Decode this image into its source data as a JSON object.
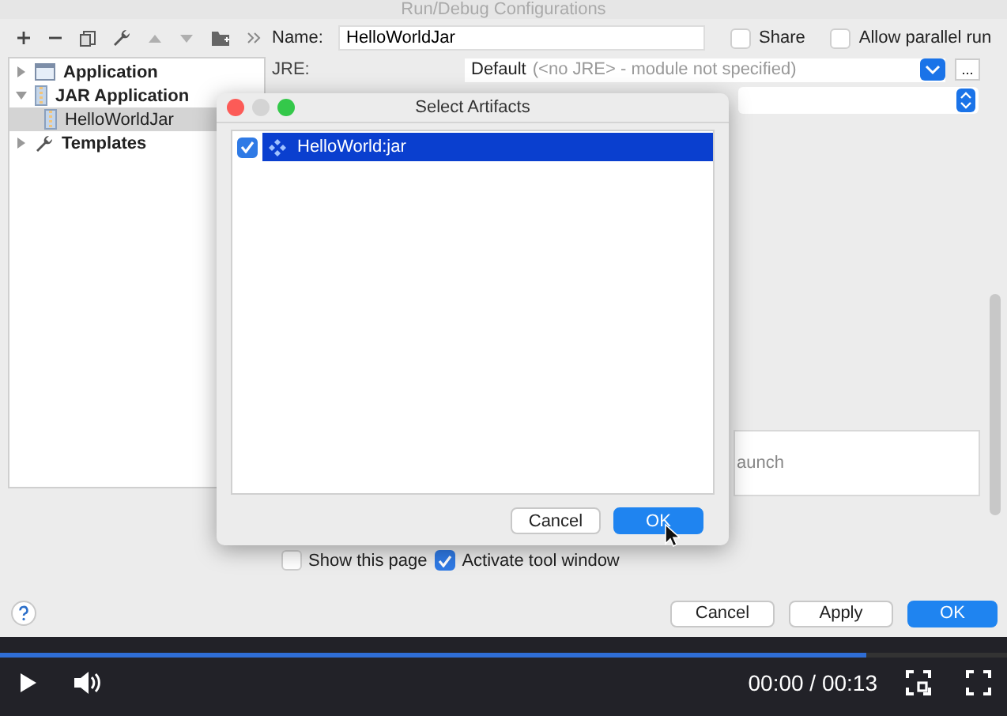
{
  "window": {
    "title": "Run/Debug Configurations"
  },
  "toolbar": [
    {
      "kind": "add",
      "disabled": false
    },
    {
      "kind": "remove",
      "disabled": false
    },
    {
      "kind": "copy",
      "disabled": false
    },
    {
      "kind": "wrench",
      "disabled": false
    },
    {
      "kind": "up",
      "disabled": true
    },
    {
      "kind": "down",
      "disabled": true
    },
    {
      "kind": "folder",
      "disabled": false
    },
    {
      "kind": "more",
      "disabled": false
    }
  ],
  "tree": [
    {
      "label": "Application",
      "kind": "application",
      "expanded": false,
      "selected": false
    },
    {
      "label": "JAR Application",
      "kind": "jar",
      "expanded": true,
      "selected": false,
      "children": [
        {
          "label": "HelloWorldJar",
          "kind": "jar",
          "selected": true
        }
      ]
    },
    {
      "label": "Templates",
      "kind": "wrench",
      "expanded": false,
      "selected": false
    }
  ],
  "config": {
    "name_label": "Name:",
    "name": "HelloWorldJar",
    "options": [
      {
        "label": "Share",
        "checked": false
      },
      {
        "label": "Allow parallel run",
        "checked": false
      }
    ],
    "jre_label": "JRE:",
    "jre_value": "Default",
    "jre_hint": "(<no JRE> - module not specified)",
    "browse": "...",
    "partial_text": "aunch",
    "after_launch": [
      {
        "label": "Show this page",
        "checked": false
      },
      {
        "label": "Activate tool window",
        "checked": true
      }
    ]
  },
  "buttons": [
    {
      "label": "Cancel",
      "default": false
    },
    {
      "label": "Apply",
      "default": false
    },
    {
      "label": "OK",
      "default": true
    }
  ],
  "modal": {
    "title": "Select Artifacts",
    "items": [
      {
        "label": "HelloWorld:jar",
        "checked": true,
        "selected": true
      }
    ],
    "buttons": [
      {
        "label": "Cancel",
        "default": false
      },
      {
        "label": "OK",
        "default": true
      }
    ]
  },
  "player": {
    "time": "00:00 / 00:13",
    "level": 0.86
  }
}
